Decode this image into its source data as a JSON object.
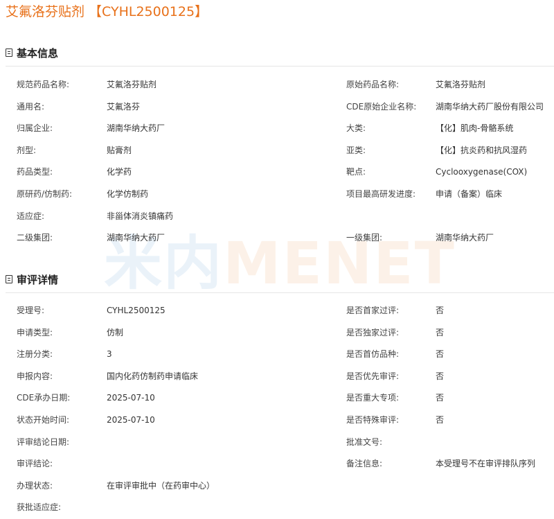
{
  "page_title": "艾氟洛芬贴剂 【CYHL2500125】",
  "watermark": {
    "part1": "米内",
    "part2": "MENET"
  },
  "basic": {
    "title": "基本信息",
    "rows": [
      {
        "l1": "规范药品名称:",
        "v1": "艾氟洛芬贴剂",
        "l2": "原始药品名称:",
        "v2": "艾氟洛芬贴剂"
      },
      {
        "l1": "通用名:",
        "v1": "艾氟洛芬",
        "l2": "CDE原始企业名称:",
        "v2": "湖南华纳大药厂股份有限公司"
      },
      {
        "l1": "归属企业:",
        "v1": "湖南华纳大药厂",
        "l2": "大类:",
        "v2": "【化】肌肉-骨骼系统"
      },
      {
        "l1": "剂型:",
        "v1": "贴膏剂",
        "l2": "亚类:",
        "v2": "【化】抗炎药和抗风湿药"
      },
      {
        "l1": "药品类型:",
        "v1": "化学药",
        "l2": "靶点:",
        "v2": "Cyclooxygenase(COX)"
      },
      {
        "l1": "原研药/仿制药:",
        "v1": "化学仿制药",
        "l2": "项目最高研发进度:",
        "v2": "申请（备案）临床"
      },
      {
        "l1": "适应症:",
        "v1": "非甾体消炎镇痛药",
        "l2": "",
        "v2": ""
      },
      {
        "l1": "二级集团:",
        "v1": "湖南华纳大药厂",
        "l2": "一级集团:",
        "v2": "湖南华纳大药厂"
      }
    ]
  },
  "review": {
    "title": "审评详情",
    "rows": [
      {
        "l1": "受理号:",
        "v1": "CYHL2500125",
        "l2": "是否首家过评:",
        "v2": "否"
      },
      {
        "l1": "申请类型:",
        "v1": "仿制",
        "l2": "是否独家过评:",
        "v2": "否"
      },
      {
        "l1": "注册分类:",
        "v1": "3",
        "l2": "是否首仿品种:",
        "v2": "否"
      },
      {
        "l1": "申报内容:",
        "v1": "国内化药仿制药申请临床",
        "l2": "是否优先审评:",
        "v2": "否"
      },
      {
        "l1": "CDE承办日期:",
        "v1": "2025-07-10",
        "l2": "是否重大专项:",
        "v2": "否"
      },
      {
        "l1": "状态开始时间:",
        "v1": "2025-07-10",
        "l2": "是否特殊审评:",
        "v2": "否"
      },
      {
        "l1": "评审结论日期:",
        "v1": "",
        "l2": "批准文号:",
        "v2": ""
      },
      {
        "l1": "审评结论:",
        "v1": "",
        "l2": "备注信息:",
        "v2": "本受理号不在审评排队序列"
      },
      {
        "l1": "办理状态:",
        "v1": "在审评审批中（在药审中心）",
        "l2": "",
        "v2": ""
      },
      {
        "l1": "获批适应症:",
        "v1": "",
        "l2": "",
        "v2": ""
      }
    ]
  }
}
